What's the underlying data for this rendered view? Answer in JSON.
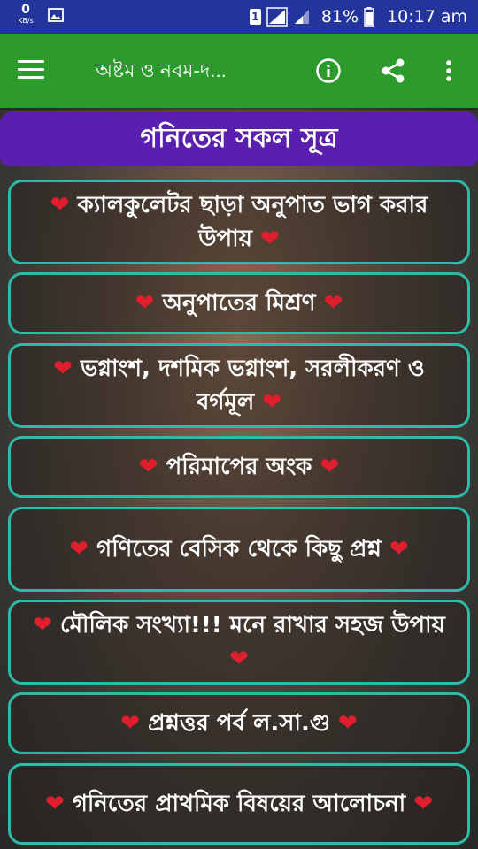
{
  "status_bar": {
    "speed_value": "0",
    "speed_unit": "KB/s",
    "sim_badge": "1",
    "battery": "81%",
    "time": "10:17 am"
  },
  "toolbar": {
    "title": "অষ্টম ও নবম-দ..."
  },
  "section": {
    "title": "গনিতের সকল সূত্র"
  },
  "list": {
    "heart": "❤",
    "items": [
      {
        "label": "ক্যালকুলেটর ছাড়া অনুপাত ভাগ করার উপায়"
      },
      {
        "label": "অনুপাতের মিশ্রণ"
      },
      {
        "label": "ভগ্নাংশ, দশমিক ভগ্নাংশ, সরলীকরণ ও বর্গমূল"
      },
      {
        "label": "পরিমাপের অংক"
      },
      {
        "label": "গণিতের বেসিক থেকে কিছু প্রশ্ন"
      },
      {
        "label": "মৌলিক সংখ্যা!!! মনে রাখার সহজ উপায়"
      },
      {
        "label": "প্রশ্নত্তর পর্ব ল.সা.গু"
      },
      {
        "label": "গনিতের প্রাথমিক বিষয়ের আলোচনা"
      }
    ]
  },
  "colors": {
    "status_bar": "#23349a",
    "toolbar": "#2d9a2c",
    "section_header": "#5b1fb0",
    "item_border": "#2bbba8",
    "heart": "#e01e2d"
  }
}
